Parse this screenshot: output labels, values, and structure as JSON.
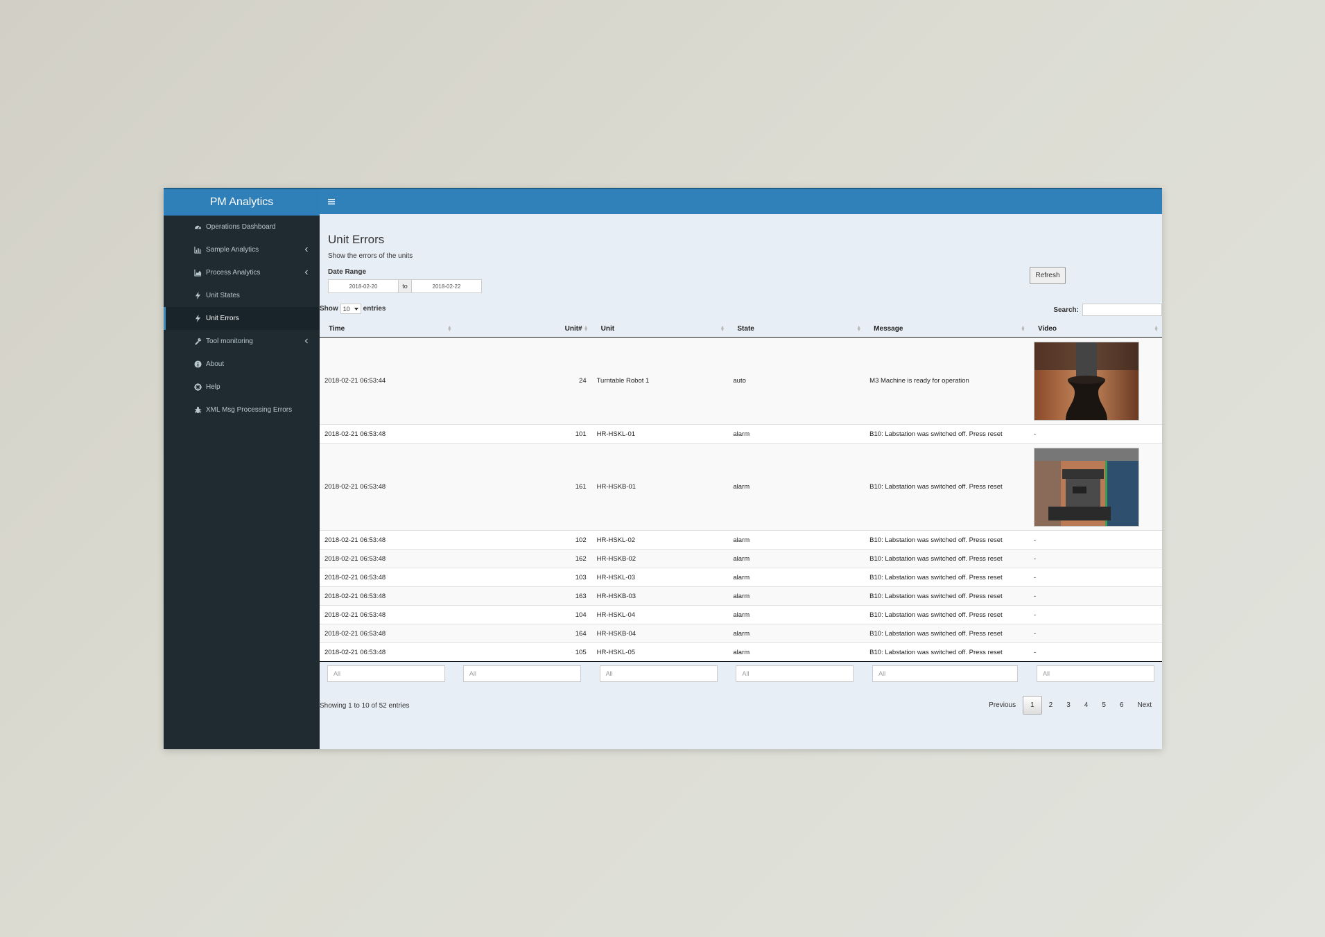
{
  "brand": "PM Analytics",
  "sidebar": {
    "items": [
      {
        "label": "Operations Dashboard",
        "icon": "dashboard-icon",
        "chevron": false
      },
      {
        "label": "Sample Analytics",
        "icon": "bar-chart-icon",
        "chevron": true
      },
      {
        "label": "Process Analytics",
        "icon": "area-chart-icon",
        "chevron": true
      },
      {
        "label": "Unit States",
        "icon": "bolt-icon",
        "chevron": false
      },
      {
        "label": "Unit Errors",
        "icon": "bolt-icon",
        "chevron": false,
        "active": true
      },
      {
        "label": "Tool monitoring",
        "icon": "wrench-icon",
        "chevron": true
      },
      {
        "label": "About",
        "icon": "info-icon",
        "chevron": false
      },
      {
        "label": "Help",
        "icon": "lifebuoy-icon",
        "chevron": false
      },
      {
        "label": "XML Msg Processing Errors",
        "icon": "bug-icon",
        "chevron": false
      }
    ]
  },
  "page": {
    "title": "Unit Errors",
    "subtitle": "Show the errors of the units",
    "date_range_label": "Date Range",
    "date_from": "2018-02-20",
    "date_sep": "to",
    "date_to": "2018-02-22",
    "refresh_label": "Refresh"
  },
  "table_ctrl": {
    "show_label": "Show",
    "length_value": "10",
    "entries_label": "entries",
    "search_label": "Search:"
  },
  "table": {
    "columns": [
      "Time",
      "Unit#",
      "Unit",
      "State",
      "Message",
      "Video"
    ],
    "rows": [
      {
        "time": "2018-02-21 06:53:44",
        "unit_no": "24",
        "unit": "Turntable Robot 1",
        "state": "auto",
        "message": "M3 Machine is ready for operation",
        "video": "thumb-turntable"
      },
      {
        "time": "2018-02-21 06:53:48",
        "unit_no": "101",
        "unit": "HR-HSKL-01",
        "state": "alarm",
        "message": "B10: Labstation was switched off. Press reset",
        "video": "-"
      },
      {
        "time": "2018-02-21 06:53:48",
        "unit_no": "161",
        "unit": "HR-HSKB-01",
        "state": "alarm",
        "message": "B10: Labstation was switched off. Press reset",
        "video": "thumb-machine"
      },
      {
        "time": "2018-02-21 06:53:48",
        "unit_no": "102",
        "unit": "HR-HSKL-02",
        "state": "alarm",
        "message": "B10: Labstation was switched off. Press reset",
        "video": "-"
      },
      {
        "time": "2018-02-21 06:53:48",
        "unit_no": "162",
        "unit": "HR-HSKB-02",
        "state": "alarm",
        "message": "B10: Labstation was switched off. Press reset",
        "video": "-"
      },
      {
        "time": "2018-02-21 06:53:48",
        "unit_no": "103",
        "unit": "HR-HSKL-03",
        "state": "alarm",
        "message": "B10: Labstation was switched off. Press reset",
        "video": "-"
      },
      {
        "time": "2018-02-21 06:53:48",
        "unit_no": "163",
        "unit": "HR-HSKB-03",
        "state": "alarm",
        "message": "B10: Labstation was switched off. Press reset",
        "video": "-"
      },
      {
        "time": "2018-02-21 06:53:48",
        "unit_no": "104",
        "unit": "HR-HSKL-04",
        "state": "alarm",
        "message": "B10: Labstation was switched off. Press reset",
        "video": "-"
      },
      {
        "time": "2018-02-21 06:53:48",
        "unit_no": "164",
        "unit": "HR-HSKB-04",
        "state": "alarm",
        "message": "B10: Labstation was switched off. Press reset",
        "video": "-"
      },
      {
        "time": "2018-02-21 06:53:48",
        "unit_no": "105",
        "unit": "HR-HSKL-05",
        "state": "alarm",
        "message": "B10: Labstation was switched off. Press reset",
        "video": "-"
      }
    ],
    "filter_placeholder": "All"
  },
  "footer": {
    "info": "Showing 1 to 10 of 52 entries",
    "pages": [
      "Previous",
      "1",
      "2",
      "3",
      "4",
      "5",
      "6",
      "Next"
    ],
    "current_page": "1"
  },
  "colors": {
    "header": "#3080ba",
    "sidebar": "#1f2b30",
    "content_bg": "#e8eef5",
    "active_accent": "#3c8dbc"
  }
}
